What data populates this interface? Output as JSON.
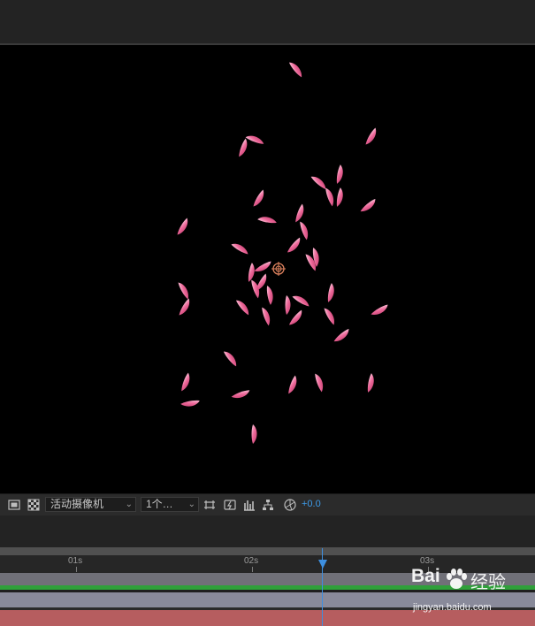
{
  "toolbar": {
    "camera_select": "活动摄像机",
    "views_select": "1个…",
    "exposure": "+0.0",
    "icons": [
      "region-icon",
      "transparency-grid-icon",
      "chevron-down-icon",
      "chevron-down-icon",
      "fit-toggle-icon",
      "snapshot-icon",
      "flowchart-icon",
      "layout-icon",
      "exposure-reset-icon"
    ]
  },
  "timeline": {
    "ruler_labels": [
      "01s",
      "02s",
      "03s"
    ]
  },
  "watermark": {
    "brand_left": "Bai",
    "brand_right": "经验",
    "url": "jingyan.baidu.com"
  },
  "colors": {
    "petal": "#e9508a",
    "petal_light": "#f8c4d8",
    "playhead": "#3d8fe0",
    "exposure": "#3d9be9",
    "layer_bar": "#898a9a",
    "audio_bar": "#b65d5f",
    "work_area": "#2fa03a"
  }
}
